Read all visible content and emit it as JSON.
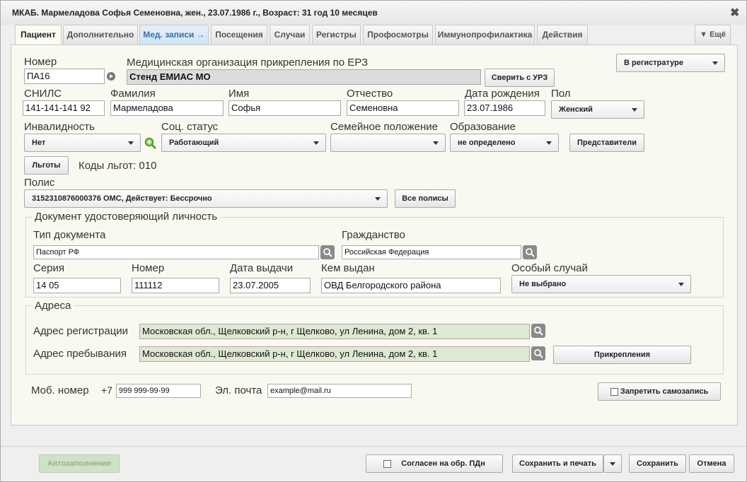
{
  "window": {
    "title": "МКАБ. Мармеладова Софья Семеновна,  жен., 23.07.1986 г., Возраст: 31 год 10 месяцев",
    "close": "✖"
  },
  "tabs": [
    "Пациент",
    "Дополнительно",
    "Мед. записи →",
    "Посещения",
    "Случаи",
    "Регистры",
    "Профосмотры",
    "Иммунопрофилактика",
    "Действия"
  ],
  "more_tab": "▼ Ещё",
  "form": {
    "nomer_label": "Номер",
    "nomer_value": "ПА16",
    "mo_label": "Медицинская организация прикрепления по ЕРЗ",
    "mo_value": "Стенд ЕМИАС МО",
    "sverit": "Сверить с УРЗ",
    "registry_state": "В регистратуре",
    "snils_label": "СНИЛС",
    "snils_value": "141-141-141 92",
    "familiya_label": "Фамилия",
    "familiya_value": "Мармеладова",
    "imya_label": "Имя",
    "imya_value": "Софья",
    "otchestvo_label": "Отчество",
    "otchestvo_value": "Семеновна",
    "dob_label": "Дата рождения",
    "dob_value": "23.07.1986",
    "pol_label": "Пол",
    "pol_value": "Женский",
    "invalid_label": "Инвалидность",
    "invalid_value": "Нет",
    "soc_label": "Соц. статус",
    "soc_value": "Работающий",
    "semya_label": "Семейное положение",
    "semya_value": "",
    "obraz_label": "Образование",
    "obraz_value": "не определено",
    "predstaviteli": "Представители",
    "lgoty": "Льготы",
    "lgoty_codes": "Коды льгот: 010",
    "polis_label": "Полис",
    "polis_value": "3152310876000376 ОМС, Действует: Бессрочно",
    "vse_polisy": "Все полисы"
  },
  "doc": {
    "legend": "Документ удостоверяющий личность",
    "tip_label": "Тип документа",
    "tip_value": "Паспорт РФ",
    "grazhd_label": "Гражданство",
    "grazhd_value": "Российская Федерация",
    "seriya_label": "Серия",
    "seriya_value": "14 05",
    "nomer_label": "Номер",
    "nomer_value": "111112",
    "data_label": "Дата выдачи",
    "data_value": "23.07.2005",
    "kem_label": "Кем выдан",
    "kem_value": "ОВД Белгородского района",
    "osoby_label": "Особый случай",
    "osoby_value": "Не выбрано"
  },
  "addr": {
    "legend": "Адреса",
    "reg_label": "Адрес регистрации",
    "reg_value": "Московская обл., Щелковский р-н, г Щелково, ул Ленина, дом 2, кв. 1",
    "preb_label": "Адрес пребывания",
    "preb_value": "Московская обл., Щелковский р-н, г Щелково, ул Ленина, дом 2, кв. 1",
    "prikrepleniya": "Прикрепления"
  },
  "contacts": {
    "mob_label": "Моб. номер",
    "mob_prefix": "+7",
    "mob_value": "999 999-99-99",
    "email_label": "Эл. почта",
    "email_value": "example@mail.ru",
    "zapret": "Запретить самозапись"
  },
  "footer": {
    "autofill": "Автозаполнение",
    "consent": "Согласен на обр. ПДн",
    "save_print": "Сохранить и печать",
    "save": "Сохранить",
    "cancel": "Отмена"
  }
}
